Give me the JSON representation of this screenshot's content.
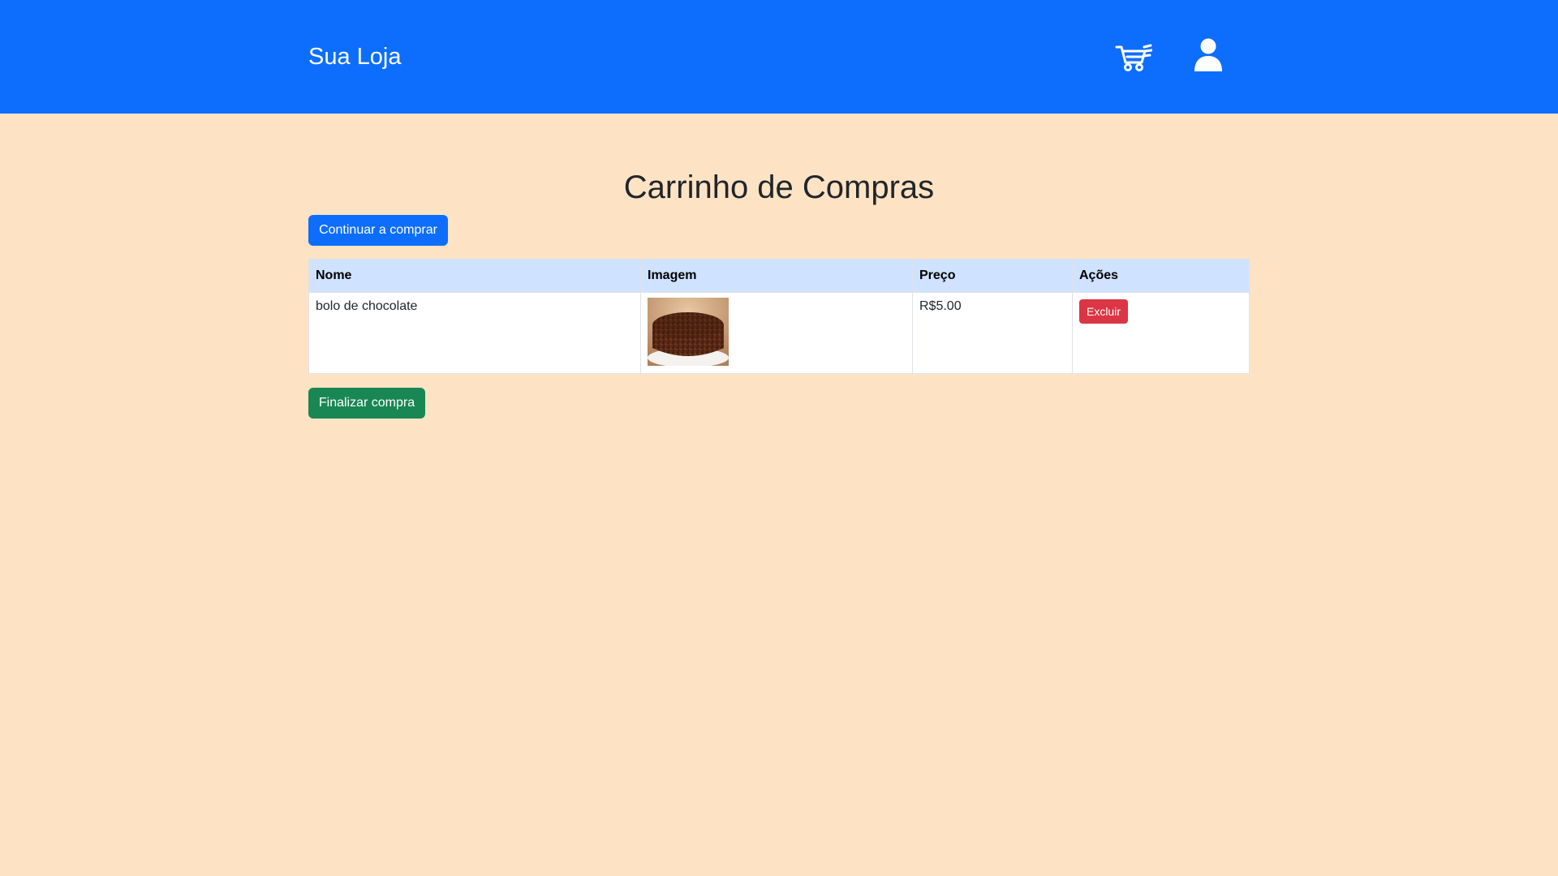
{
  "header": {
    "brand": "Sua Loja",
    "background": "#0d6efd",
    "cart_icon": "cart-icon",
    "user_icon": "user-icon"
  },
  "main": {
    "title": "Carrinho de Compras",
    "continue_label": "Continuar a comprar",
    "finish_label": "Finalizar compra",
    "table": {
      "headers": [
        "Nome",
        "Imagem",
        "Preço",
        "Ações"
      ],
      "rows": [
        {
          "name": "bolo de chocolate",
          "image": "chocolate-cake-image",
          "price": "R$5.00",
          "action_label": "Excluir"
        }
      ]
    }
  },
  "colors": {
    "page_background": "#fde3c4",
    "primary": "#0d6efd",
    "success": "#198754",
    "danger": "#dc3545",
    "table_header": "#cfe2ff"
  }
}
